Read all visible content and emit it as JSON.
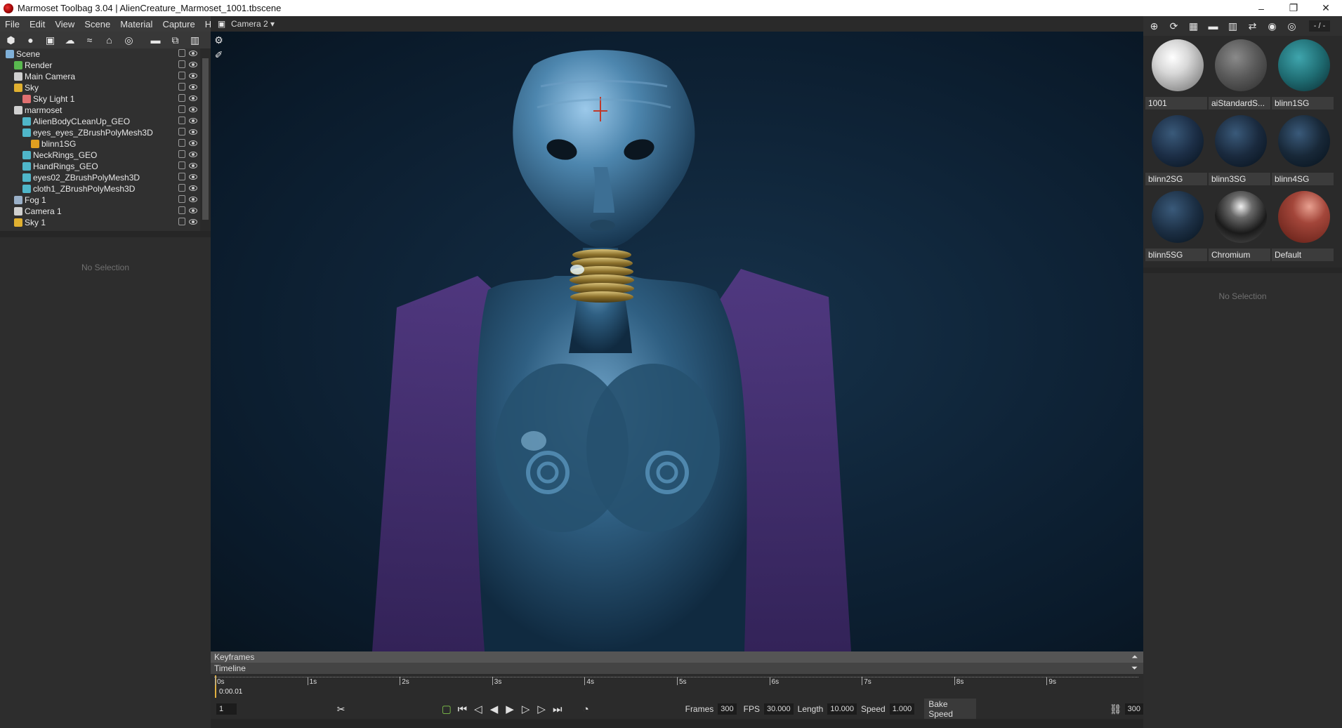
{
  "window": {
    "title": "Marmoset Toolbag 3.04  |  AlienCreature_Marmoset_1001.tbscene",
    "controls": [
      "–",
      "❐",
      "✕"
    ]
  },
  "menu": [
    "File",
    "Edit",
    "View",
    "Scene",
    "Material",
    "Capture",
    "Help"
  ],
  "scene_tree": [
    {
      "label": "Scene",
      "indent": 0,
      "icon": "scene-icon",
      "color": "#7fb0d8"
    },
    {
      "label": "Render",
      "indent": 1,
      "icon": "render-icon",
      "color": "#59b84f"
    },
    {
      "label": "Main Camera",
      "indent": 1,
      "icon": "camera-icon",
      "color": "#cfcfcf"
    },
    {
      "label": "Sky",
      "indent": 1,
      "icon": "sky-icon",
      "color": "#e0b030"
    },
    {
      "label": "Sky Light 1",
      "indent": 2,
      "icon": "light-icon",
      "color": "#e07070"
    },
    {
      "label": "marmoset",
      "indent": 1,
      "icon": "object-icon",
      "color": "#d0d0d0"
    },
    {
      "label": "AlienBodyCLeanUp_GEO",
      "indent": 2,
      "icon": "mesh-icon",
      "color": "#4fb6c9"
    },
    {
      "label": "eyes_eyes_ZBrushPolyMesh3D",
      "indent": 2,
      "icon": "mesh-icon",
      "color": "#4fb6c9"
    },
    {
      "label": "blinn1SG",
      "indent": 3,
      "icon": "material-icon",
      "color": "#e0a020"
    },
    {
      "label": "NeckRings_GEO",
      "indent": 2,
      "icon": "mesh-icon",
      "color": "#4fb6c9"
    },
    {
      "label": "HandRings_GEO",
      "indent": 2,
      "icon": "mesh-icon",
      "color": "#4fb6c9"
    },
    {
      "label": "eyes02_ZBrushPolyMesh3D",
      "indent": 2,
      "icon": "mesh-icon",
      "color": "#4fb6c9"
    },
    {
      "label": "cloth1_ZBrushPolyMesh3D",
      "indent": 2,
      "icon": "mesh-icon",
      "color": "#4fb6c9"
    },
    {
      "label": "Fog 1",
      "indent": 1,
      "icon": "fog-icon",
      "color": "#9ab0c8"
    },
    {
      "label": "Camera 1",
      "indent": 1,
      "icon": "camera-icon",
      "color": "#cfcfcf"
    },
    {
      "label": "Sky 1",
      "indent": 1,
      "icon": "sky-icon",
      "color": "#e0b030"
    }
  ],
  "left_props": {
    "empty": "No Selection"
  },
  "viewport": {
    "camera_label": "Camera 2 ▾"
  },
  "timeline": {
    "keyframes_label": "Keyframes",
    "timeline_label": "Timeline",
    "ticks": [
      "0s",
      "1s",
      "2s",
      "3s",
      "4s",
      "5s",
      "6s",
      "7s",
      "8s",
      "9s"
    ],
    "current_time": "0:00.01",
    "frame_value": "1",
    "frames_label": "Frames",
    "frames_value": "300",
    "fps_label": "FPS",
    "fps_value": "30.000",
    "length_label": "Length",
    "length_value": "10.000",
    "speed_label": "Speed",
    "speed_value": "1.000",
    "bake_label": "Bake Speed",
    "end_value": "300"
  },
  "materials": [
    {
      "name": "1001",
      "color": "#cfcfcf",
      "style": "white"
    },
    {
      "name": "aiStandardS...",
      "color": "#5a5a5a",
      "style": "grey"
    },
    {
      "name": "blinn1SG",
      "color": "#1f6c72",
      "style": "teal"
    },
    {
      "name": "blinn2SG",
      "color": "#1c2e46",
      "style": "dark"
    },
    {
      "name": "blinn3SG",
      "color": "#1a2a3e",
      "style": "dark"
    },
    {
      "name": "blinn4SG",
      "color": "#182838",
      "style": "dark"
    },
    {
      "name": "blinn5SG",
      "color": "#1c2f44",
      "style": "dark"
    },
    {
      "name": "Chromium",
      "color": "#2a2a2a",
      "style": "chrome"
    },
    {
      "name": "Default",
      "color": "#8a3025",
      "style": "red"
    }
  ],
  "right_toolbar_field": "- / -",
  "right_props": {
    "empty": "No Selection"
  }
}
